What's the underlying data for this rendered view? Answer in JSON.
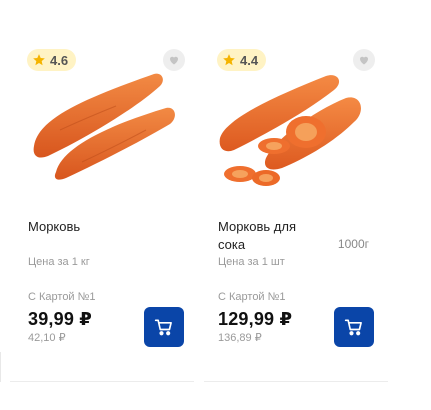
{
  "products": [
    {
      "rating": "4.6",
      "name": "Морковь",
      "weight": "",
      "unit_label": "Цена за 1 кг",
      "card_label": "С Картой №1",
      "price": "39,99 ₽",
      "old_price": "42,10 ₽"
    },
    {
      "rating": "4.4",
      "name": "Морковь для сока",
      "weight": "1000г",
      "unit_label": "Цена за 1 шт",
      "card_label": "С Картой №1",
      "price": "129,99 ₽",
      "old_price": "136,89 ₽"
    }
  ],
  "icons": {
    "rating": "star-icon",
    "favorite": "heart-icon",
    "cart": "shopping-cart-icon"
  },
  "colors": {
    "rating_bg": "#fff3c4",
    "star": "#f5b400",
    "cart_button": "#0a45a8",
    "carrot": "#ef6f2e"
  }
}
